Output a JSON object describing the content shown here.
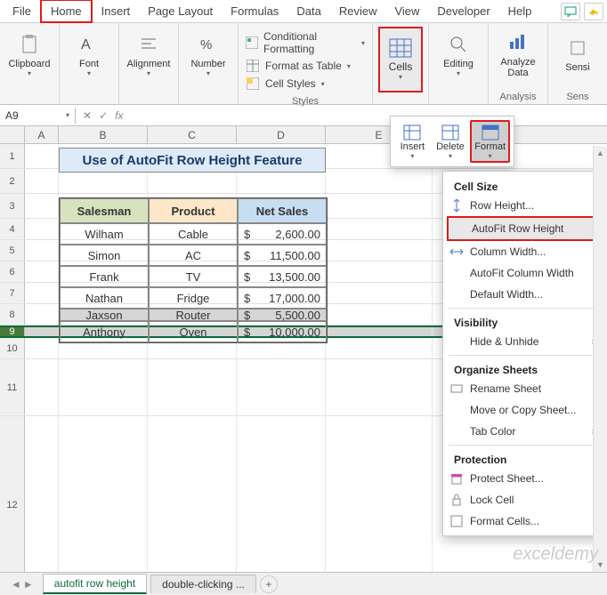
{
  "menubar": {
    "tabs": [
      "File",
      "Home",
      "Insert",
      "Page Layout",
      "Formulas",
      "Data",
      "Review",
      "View",
      "Developer",
      "Help"
    ],
    "active": "Home"
  },
  "ribbon": {
    "clipboard": {
      "label": "Clipboard"
    },
    "font": {
      "label": "Font"
    },
    "alignment": {
      "label": "Alignment"
    },
    "number": {
      "label": "Number"
    },
    "styles": {
      "label": "Styles",
      "conditional": "Conditional Formatting",
      "table": "Format as Table",
      "cell": "Cell Styles"
    },
    "cells": {
      "label": "Cells"
    },
    "editing": {
      "label": "Editing"
    },
    "analysis": {
      "label": "Analysis",
      "btn": "Analyze Data"
    },
    "sens": {
      "label": "Sens",
      "btn": "Sensi"
    }
  },
  "namebox": {
    "value": "A9"
  },
  "fx_label": "fx",
  "columns": [
    "A",
    "B",
    "C",
    "D",
    "E"
  ],
  "rows": [
    "1",
    "2",
    "3",
    "4",
    "5",
    "6",
    "7",
    "8",
    "9",
    "10",
    "11",
    "12"
  ],
  "title_cell": "Use of AutoFit Row Height Feature",
  "table": {
    "headers": {
      "b": "Salesman",
      "c": "Product",
      "d": "Net Sales"
    },
    "rows": [
      {
        "b": "Wilham",
        "c": "Cable",
        "cur": "$",
        "d": "2,600.00"
      },
      {
        "b": "Simon",
        "c": "AC",
        "cur": "$",
        "d": "11,500.00"
      },
      {
        "b": "Frank",
        "c": "TV",
        "cur": "$",
        "d": "13,500.00"
      },
      {
        "b": "Nathan",
        "c": "Fridge",
        "cur": "$",
        "d": "17,000.00"
      },
      {
        "b": "Jaxson",
        "c": "Router",
        "cur": "$",
        "d": "5,500.00"
      },
      {
        "b": "Anthony",
        "c": "Oven",
        "cur": "$",
        "d": "10,000.00"
      }
    ]
  },
  "cells_panel": {
    "insert": "Insert",
    "delete": "Delete",
    "format": "Format"
  },
  "format_menu": {
    "cell_size": "Cell Size",
    "row_height": "Row Height...",
    "autofit_row": "AutoFit Row Height",
    "col_width": "Column Width...",
    "autofit_col": "AutoFit Column Width",
    "default_width": "Default Width...",
    "visibility": "Visibility",
    "hide": "Hide & Unhide",
    "organize": "Organize Sheets",
    "rename": "Rename Sheet",
    "move": "Move or Copy Sheet...",
    "tab_color": "Tab Color",
    "protection": "Protection",
    "protect": "Protect Sheet...",
    "lock": "Lock Cell",
    "format_cells": "Format Cells..."
  },
  "sheets": {
    "active": "autofit row height",
    "other": "double-clicking  ..."
  },
  "watermark": "exceldemy"
}
